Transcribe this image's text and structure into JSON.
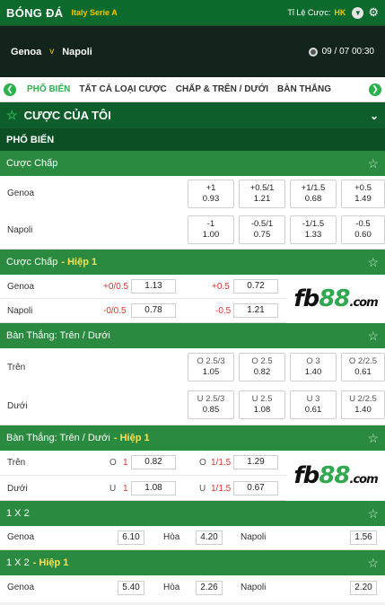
{
  "top": {
    "title": "BÓNG ĐÁ",
    "league": "Italy Serie A",
    "odds_label": "Tỉ Lệ Cược:",
    "odds_value": "HK"
  },
  "match": {
    "home": "Genoa",
    "vs": "v",
    "away": "Napoli",
    "datetime": "09 / 07  00:30"
  },
  "tabs": [
    "PHỔ BIẾN",
    "TẤT CẢ LOẠI CƯỢC",
    "CHẤP & TRÊN / DƯỚI",
    "BÀN THẮNG"
  ],
  "my_bets": "CƯỢC CỦA TÔI",
  "popular": "PHỔ BIẾN",
  "handicap": {
    "title": "Cược Chấp",
    "rows": [
      {
        "team": "Genoa",
        "cells": [
          [
            "+1",
            "0.93"
          ],
          [
            "+0.5/1",
            "1.21"
          ],
          [
            "+1/1.5",
            "0.68"
          ],
          [
            "+0.5",
            "1.49"
          ]
        ]
      },
      {
        "team": "Napoli",
        "cells": [
          [
            "-1",
            "1.00"
          ],
          [
            "-0.5/1",
            "0.75"
          ],
          [
            "-1/1.5",
            "1.33"
          ],
          [
            "-0.5",
            "0.60"
          ]
        ]
      }
    ]
  },
  "handicap_h1": {
    "title": "Cược Chấp",
    "half": "- Hiệp 1",
    "rows": [
      {
        "team": "Genoa",
        "l1": "+0/0.5",
        "v1": "1.13",
        "l2": "+0.5",
        "v2": "0.72"
      },
      {
        "team": "Napoli",
        "l1": "-0/0.5",
        "v1": "0.78",
        "l2": "-0.5",
        "v2": "1.21"
      }
    ]
  },
  "ou": {
    "title": "Bàn Thắng: Trên / Dưới",
    "rows": [
      {
        "label": "Trên",
        "cells": [
          [
            "O 2.5/3",
            "1.05"
          ],
          [
            "O 2.5",
            "0.82"
          ],
          [
            "O 3",
            "1.40"
          ],
          [
            "O 2/2.5",
            "0.61"
          ]
        ]
      },
      {
        "label": "Dưới",
        "cells": [
          [
            "U 2.5/3",
            "0.85"
          ],
          [
            "U 2.5",
            "1.08"
          ],
          [
            "U 3",
            "0.61"
          ],
          [
            "U 2/2.5",
            "1.40"
          ]
        ]
      }
    ]
  },
  "ou_h1": {
    "title": "Bàn Thắng: Trên / Dưới",
    "half": "- Hiệp 1",
    "rows": [
      {
        "label": "Trên",
        "l1": "O",
        "n1": "1",
        "v1": "0.82",
        "l2": "O",
        "n2": "1/1.5",
        "v2": "1.29"
      },
      {
        "label": "Dưới",
        "l1": "U",
        "n1": "1",
        "v1": "1.08",
        "l2": "U",
        "n2": "1/1.5",
        "v2": "0.67"
      }
    ]
  },
  "x12": {
    "title": "1 X 2",
    "home": "Genoa",
    "hv": "6.10",
    "draw": "Hòa",
    "dv": "4.20",
    "away": "Napoli",
    "av": "1.56"
  },
  "x12_h1": {
    "title": "1 X 2",
    "half": "- Hiệp 1",
    "home": "Genoa",
    "hv": "5.40",
    "draw": "Hòa",
    "dv": "2.26",
    "away": "Napoli",
    "av": "2.20"
  },
  "ad": {
    "a": "fb",
    "b": "88",
    "c": ".com"
  },
  "colors": {
    "brand_green": "#0c6b2c",
    "accent": "#2bb24c",
    "highlight": "#ffe14d",
    "negative": "#d9362b"
  }
}
